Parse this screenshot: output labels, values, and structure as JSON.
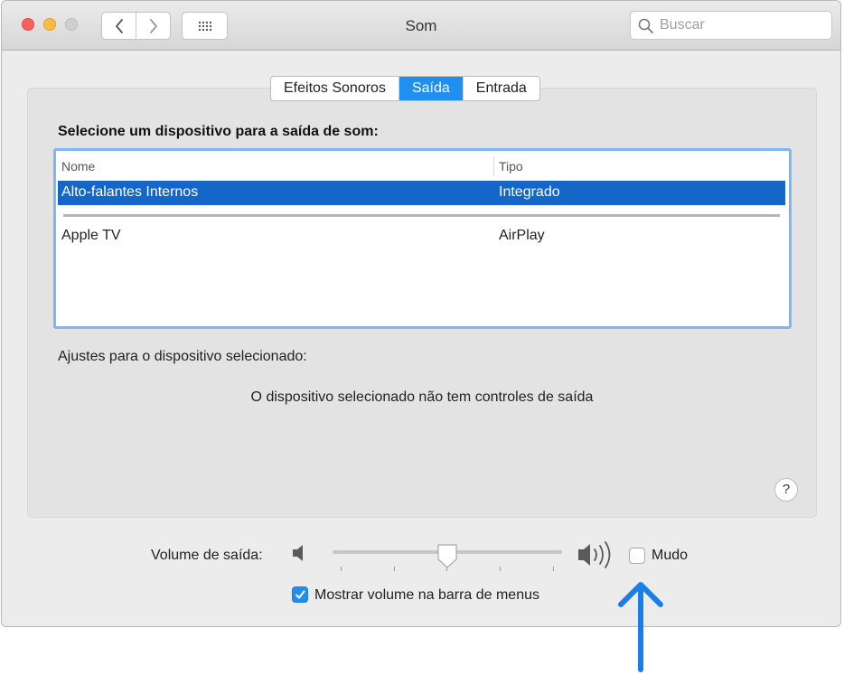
{
  "window": {
    "title": "Som",
    "search_placeholder": "Buscar"
  },
  "tabs": [
    {
      "label": "Efeitos Sonoros",
      "active": false
    },
    {
      "label": "Saída",
      "active": true
    },
    {
      "label": "Entrada",
      "active": false
    }
  ],
  "output": {
    "heading": "Selecione um dispositivo para a saída de som:",
    "columns": [
      "Nome",
      "Tipo"
    ],
    "devices": [
      {
        "name": "Alto-falantes Internos",
        "type": "Integrado",
        "selected": true
      },
      {
        "name": "Apple TV",
        "type": "AirPlay",
        "selected": false
      }
    ],
    "settings_label": "Ajustes para o dispositivo selecionado:",
    "no_controls_message": "O dispositivo selecionado não tem controles de saída",
    "help_label": "?"
  },
  "volume": {
    "label": "Volume de saída:",
    "level": 0.5,
    "mute_label": "Mudo",
    "mute_checked": false,
    "show_in_menubar_label": "Mostrar volume na barra de menus",
    "show_in_menubar_checked": true
  },
  "colors": {
    "accent": "#1f8ff0",
    "selection": "#1467c9",
    "annotation_arrow": "#1a7ee6"
  },
  "icons": [
    "back-icon",
    "forward-icon",
    "grid-icon",
    "search-icon",
    "speaker-low-icon",
    "speaker-high-icon",
    "help-icon",
    "checkmark-icon",
    "annotation-arrow-icon"
  ]
}
